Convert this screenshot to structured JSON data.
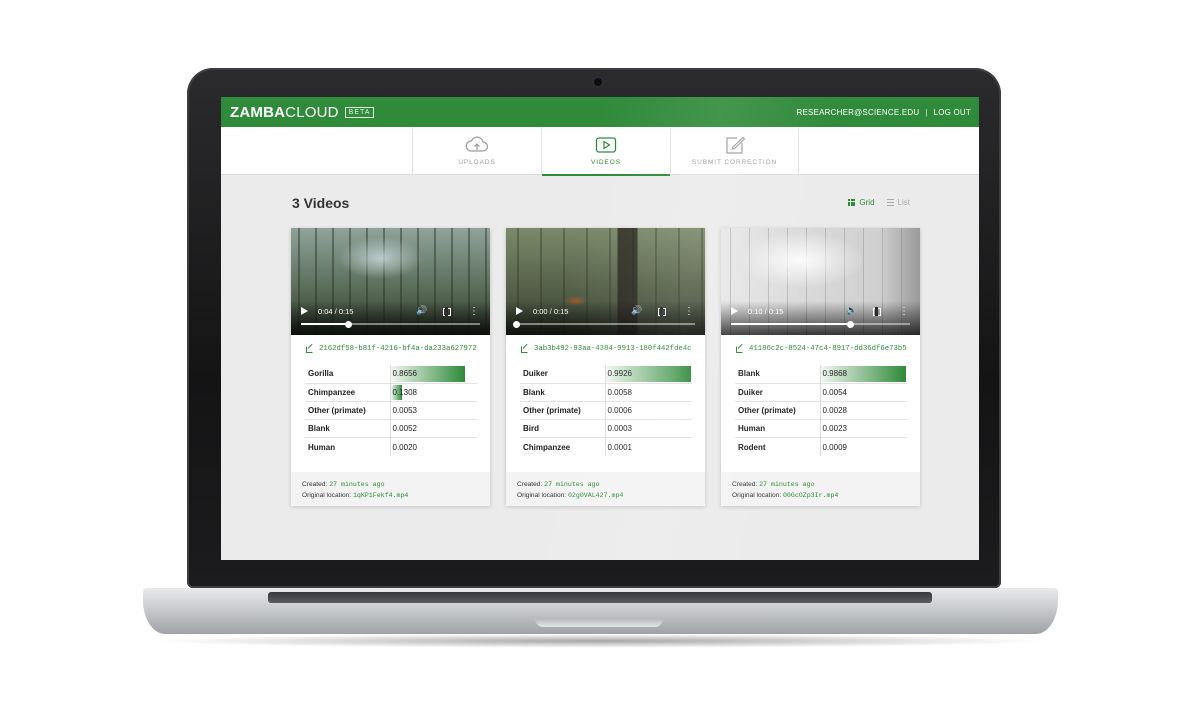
{
  "header": {
    "brand_bold": "ZAMBA",
    "brand_light": "CLOUD",
    "badge": "BETA",
    "user_email": "RESEARCHER@SCIENCE.EDU",
    "separator": "|",
    "logout_label": "LOG OUT"
  },
  "nav": {
    "tabs": [
      {
        "label": "UPLOADS",
        "icon": "cloud-upload-icon",
        "active": false
      },
      {
        "label": "VIDEOS",
        "icon": "video-play-icon",
        "active": true
      },
      {
        "label": "SUBMIT CORRECTION",
        "icon": "edit-icon",
        "active": false
      }
    ]
  },
  "main": {
    "title": "3 Videos",
    "view_options": [
      {
        "label": "Grid",
        "icon": "grid-icon",
        "selected": true
      },
      {
        "label": "List",
        "icon": "list-icon",
        "selected": false
      }
    ]
  },
  "theme": {
    "accent": "#2f8a39",
    "background": "#ebebeb"
  },
  "videos": [
    {
      "time": "0:04 / 0:15",
      "progress": 0.267,
      "id": "2162df58-b81f-4216-bf4a-da233a627972",
      "predictions": [
        {
          "label": "Gorilla",
          "value": "0.8656",
          "score": 0.8656
        },
        {
          "label": "Chimpanzee",
          "value": "0.1308",
          "score": 0.1308
        },
        {
          "label": "Other (primate)",
          "value": "0.0053",
          "score": 0.0053
        },
        {
          "label": "Blank",
          "value": "0.0052",
          "score": 0.0052
        },
        {
          "label": "Human",
          "value": "0.0020",
          "score": 0.002
        }
      ],
      "created_label": "Created:",
      "created": "27 minutes ago",
      "location_label": "Original location:",
      "location": "1qKP1Fekf4.mp4"
    },
    {
      "time": "0:00 / 0:15",
      "progress": 0.0,
      "id": "3ab3b492-93aa-4384-9913-180f442fde4c",
      "predictions": [
        {
          "label": "Duiker",
          "value": "0.9926",
          "score": 0.9926
        },
        {
          "label": "Blank",
          "value": "0.0058",
          "score": 0.0058
        },
        {
          "label": "Other (primate)",
          "value": "0.0006",
          "score": 0.0006
        },
        {
          "label": "Bird",
          "value": "0.0003",
          "score": 0.0003
        },
        {
          "label": "Chimpanzee",
          "value": "0.0001",
          "score": 0.0001
        }
      ],
      "created_label": "Created:",
      "created": "27 minutes ago",
      "location_label": "Original location:",
      "location": "02g0VAL427.mp4"
    },
    {
      "time": "0:10 / 0:15",
      "progress": 0.667,
      "id": "41186c2c-8524-47c4-8917-dd36df6e73b5",
      "predictions": [
        {
          "label": "Blank",
          "value": "0.9868",
          "score": 0.9868
        },
        {
          "label": "Duiker",
          "value": "0.0054",
          "score": 0.0054
        },
        {
          "label": "Other (primate)",
          "value": "0.0028",
          "score": 0.0028
        },
        {
          "label": "Human",
          "value": "0.0023",
          "score": 0.0023
        },
        {
          "label": "Rodent",
          "value": "0.0009",
          "score": 0.0009
        }
      ],
      "created_label": "Created:",
      "created": "27 minutes ago",
      "location_label": "Original location:",
      "location": "00GcOZp3Ir.mp4"
    }
  ]
}
